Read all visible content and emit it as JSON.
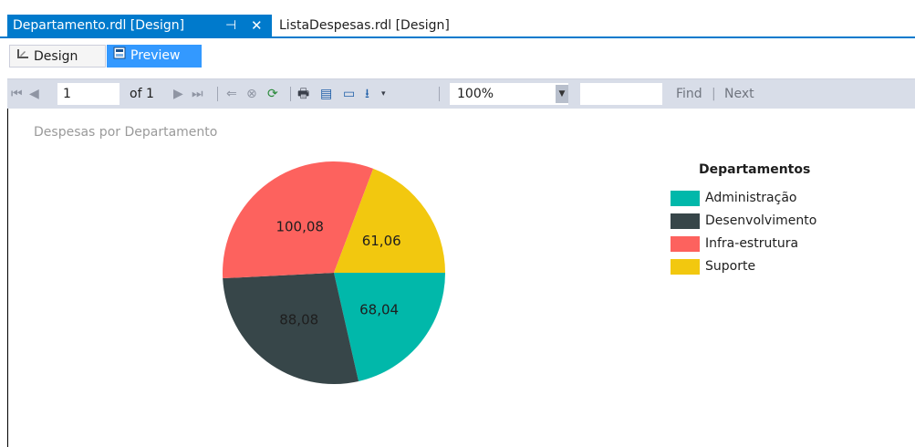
{
  "tabs": {
    "active": {
      "title": "Departamento.rdl [Design]",
      "pin_glyph": "⊣",
      "close_glyph": "✕"
    },
    "inactive": {
      "title": "ListaDespesas.rdl [Design]"
    }
  },
  "view_tabs": {
    "design": {
      "label": "Design",
      "icon": "design-icon"
    },
    "preview": {
      "label": "Preview",
      "icon": "preview-icon"
    }
  },
  "toolbar": {
    "page_value": "1",
    "of_text": "of 1",
    "zoom": "100%",
    "find_label": "Find",
    "find_sep": "|",
    "next_label": "Next",
    "icons": {
      "first": "⏮",
      "prev": "◀",
      "next": "▶",
      "last": "⏭",
      "back": "⇐",
      "stop": "⊗",
      "refresh": "⟳",
      "print": "🖶",
      "layout": "▤",
      "page_setup": "▭",
      "export": "⭳"
    }
  },
  "report": {
    "title": "Despesas por Departamento"
  },
  "chart_data": {
    "type": "pie",
    "title": "Despesas por Departamento",
    "legend_title": "Departamentos",
    "legend_position": "right",
    "slices": [
      {
        "name": "Administração",
        "value": 68.04,
        "label": "68,04",
        "color": "#01b8aa",
        "label_color": "#1e1e1e"
      },
      {
        "name": "Desenvolvimento",
        "value": 88.08,
        "label": "88,08",
        "color": "#374649",
        "label_color": "#1e1e1e"
      },
      {
        "name": "Infra-estrutura",
        "value": 100.08,
        "label": "100,08",
        "color": "#fd625e",
        "label_color": "#1e1e1e"
      },
      {
        "name": "Suporte",
        "value": 61.06,
        "label": "61,06",
        "color": "#f2c80f",
        "label_color": "#1e1e1e"
      }
    ]
  }
}
